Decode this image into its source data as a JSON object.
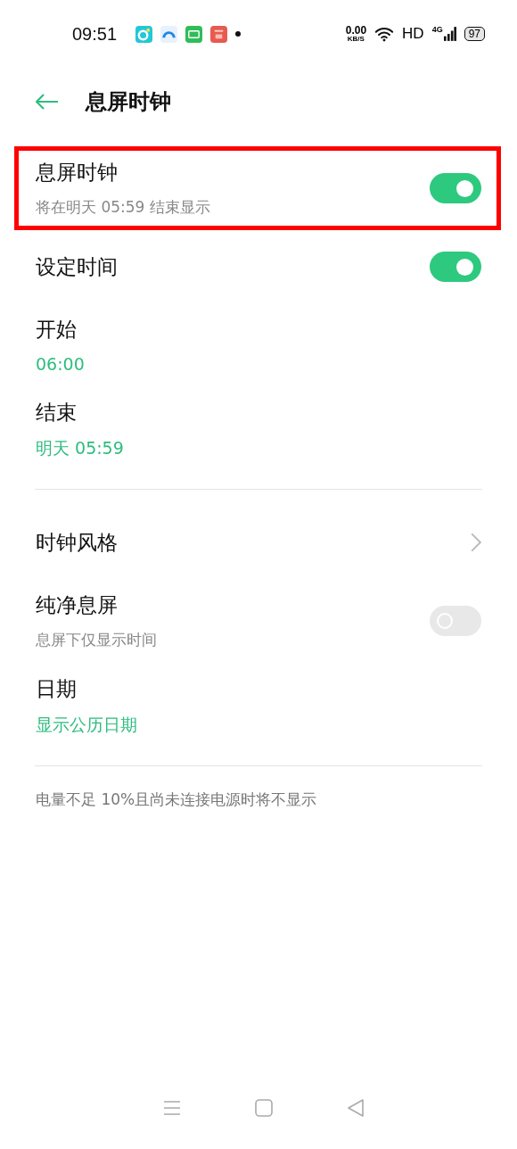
{
  "status_bar": {
    "time": "09:51",
    "net_speed": "0.00",
    "net_unit": "KB/S",
    "hd": "HD",
    "network": "4G",
    "battery": "97"
  },
  "header": {
    "title": "息屏时钟"
  },
  "sections": [
    {
      "items": [
        {
          "kind": "toggle",
          "title": "息屏时钟",
          "subtitle": "将在明天  05:59 结束显示",
          "on": true,
          "highlighted": true
        },
        {
          "kind": "toggle",
          "title": "设定时间",
          "on": true,
          "highlighted": false
        },
        {
          "kind": "value",
          "title": "开始",
          "value": "06:00"
        },
        {
          "kind": "value",
          "title": "结束",
          "value": "明天 05:59"
        }
      ]
    },
    {
      "items": [
        {
          "kind": "link",
          "title": "时钟风格"
        },
        {
          "kind": "toggle",
          "title": "纯净息屏",
          "subtitle": "息屏下仅显示时间",
          "on": false,
          "highlighted": false
        },
        {
          "kind": "value",
          "title": "日期",
          "value": "显示公历日期"
        }
      ]
    }
  ],
  "note": "电量不足 10%且尚未连接电源时将不显示"
}
